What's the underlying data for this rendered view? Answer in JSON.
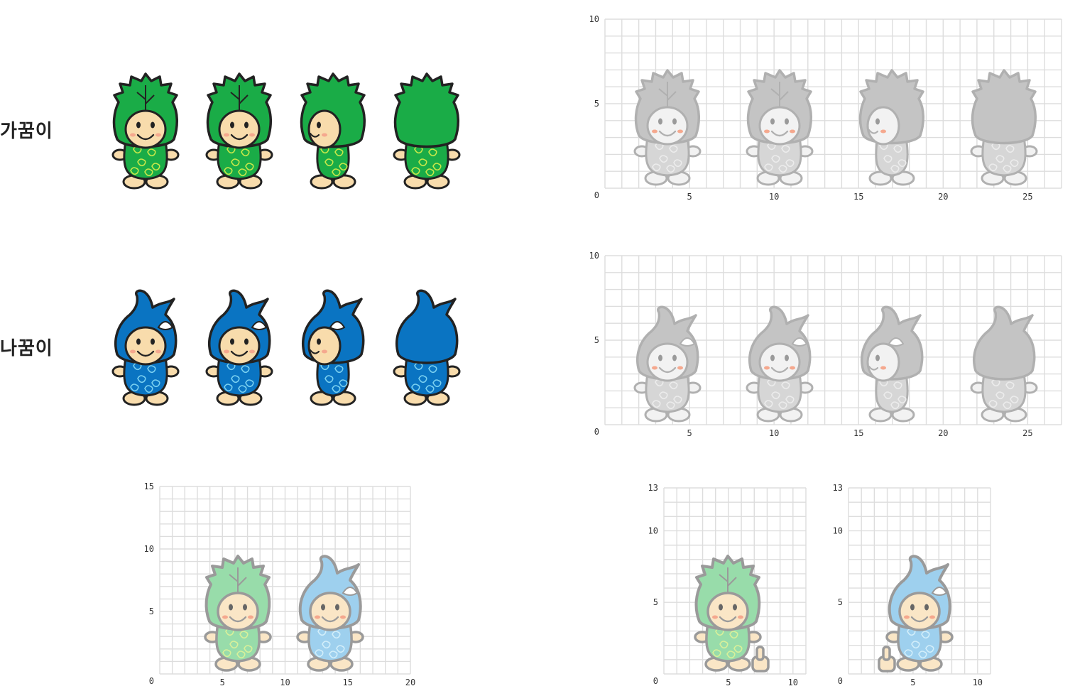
{
  "rows": [
    {
      "label": "가꿈이",
      "theme": "cabbage",
      "color": "#1aac47",
      "pattern_color": "#c8e84a"
    },
    {
      "label": "나꿈이",
      "theme": "droplet",
      "color": "#0a74c2",
      "pattern_color": "#7ad0f0"
    }
  ],
  "grids": {
    "cabbage_grid": {
      "y_ticks": [
        "0",
        "5",
        "10"
      ],
      "x_ticks": [
        "5",
        "10",
        "15",
        "20",
        "25"
      ]
    },
    "droplet_grid": {
      "y_ticks": [
        "0",
        "5",
        "10"
      ],
      "x_ticks": [
        "5",
        "10",
        "15",
        "20",
        "25"
      ]
    },
    "pair_grid": {
      "y_ticks": [
        "0",
        "5",
        "10",
        "15"
      ],
      "x_ticks": [
        "5",
        "10",
        "15",
        "20"
      ]
    },
    "thumb_cabbage_grid": {
      "y_ticks": [
        "0",
        "5",
        "10",
        "13"
      ],
      "x_ticks": [
        "5",
        "10"
      ]
    },
    "thumb_droplet_grid": {
      "y_ticks": [
        "0",
        "5",
        "10",
        "13"
      ],
      "x_ticks": [
        "5",
        "10"
      ]
    }
  },
  "colors": {
    "skin": "#f8dcac",
    "outline": "#222222",
    "grid_line": "#dddddd",
    "faded_gray": "#c4c4c4",
    "faded_green": "#98dcaa",
    "faded_blue": "#9ed0ee",
    "cheek": "#f5a88e"
  }
}
